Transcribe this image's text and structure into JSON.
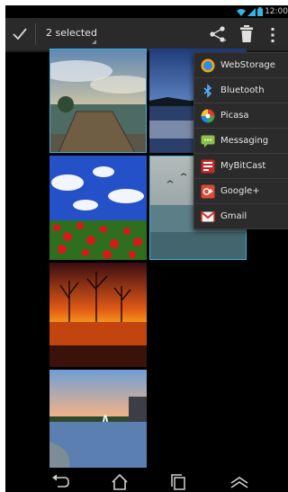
{
  "status_bar": {
    "time": "12:00",
    "icons": [
      "wifi-icon",
      "signal-icon",
      "battery-icon"
    ]
  },
  "action_bar": {
    "selection_text": "2 selected",
    "icons": [
      "checkmark-icon",
      "share-icon",
      "trash-icon",
      "overflow-menu-icon"
    ]
  },
  "share_menu": {
    "items": [
      {
        "label": "WebStorage",
        "icon": "webstorage-icon"
      },
      {
        "label": "Bluetooth",
        "icon": "bluetooth-icon"
      },
      {
        "label": "Picasa",
        "icon": "picasa-icon"
      },
      {
        "label": "Messaging",
        "icon": "messaging-icon"
      },
      {
        "label": "MyBitCast",
        "icon": "mybitcast-icon"
      },
      {
        "label": "Google+",
        "icon": "google-plus-icon"
      },
      {
        "label": "Gmail",
        "icon": "gmail-icon"
      }
    ]
  },
  "gallery": {
    "photos": [
      {
        "subject": "wooden pier under cloudy sky",
        "selected": true
      },
      {
        "subject": "lake at dusk with blue sky",
        "selected": false
      },
      {
        "subject": "red poppy field under blue sky",
        "selected": false
      },
      {
        "subject": "birds over misty lake",
        "selected": true
      },
      {
        "subject": "bare trees at orange sunset over water",
        "selected": false
      },
      {
        "subject": "fountain in lake at sunset",
        "selected": false
      }
    ]
  },
  "navigation_bar": {
    "buttons": [
      "back-icon",
      "home-icon",
      "recent-apps-icon",
      "menu-icon"
    ]
  },
  "colors": {
    "accent": "#33b5e5",
    "action_bar": "#2a2a2a",
    "menu_background": "#2b2b2b"
  }
}
